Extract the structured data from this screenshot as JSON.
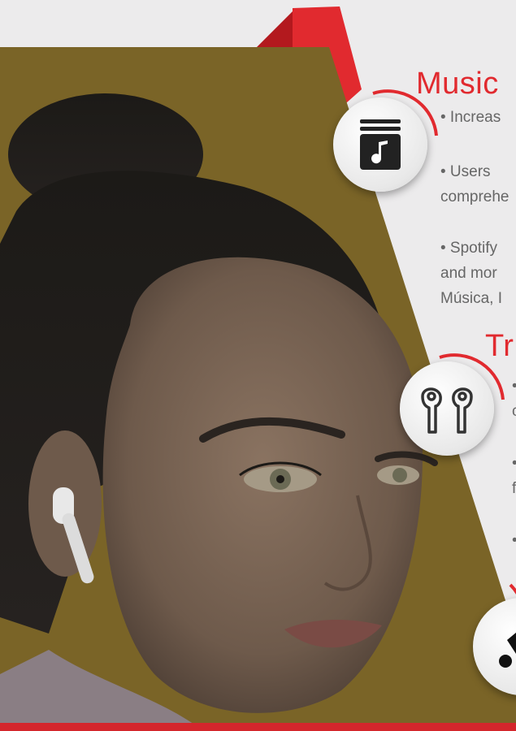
{
  "sections": [
    {
      "title": "Music",
      "icon": "music-album-icon",
      "bullets": [
        "• Increas",
        "•  Users",
        "comprehe",
        "• Spotify",
        "and  mor",
        "Música, I"
      ]
    },
    {
      "title": "Tr",
      "icon": "earbuds-icon",
      "bullets": [
        "•",
        "c",
        "•",
        "fa",
        "•"
      ]
    },
    {
      "icon": "tag-icon"
    }
  ],
  "colors": {
    "accent": "#e12a2f",
    "ribbon_dark": "#b3191e",
    "panel_overlay": "#7a6427",
    "background": "#ecebec",
    "text_gray": "#666666"
  }
}
